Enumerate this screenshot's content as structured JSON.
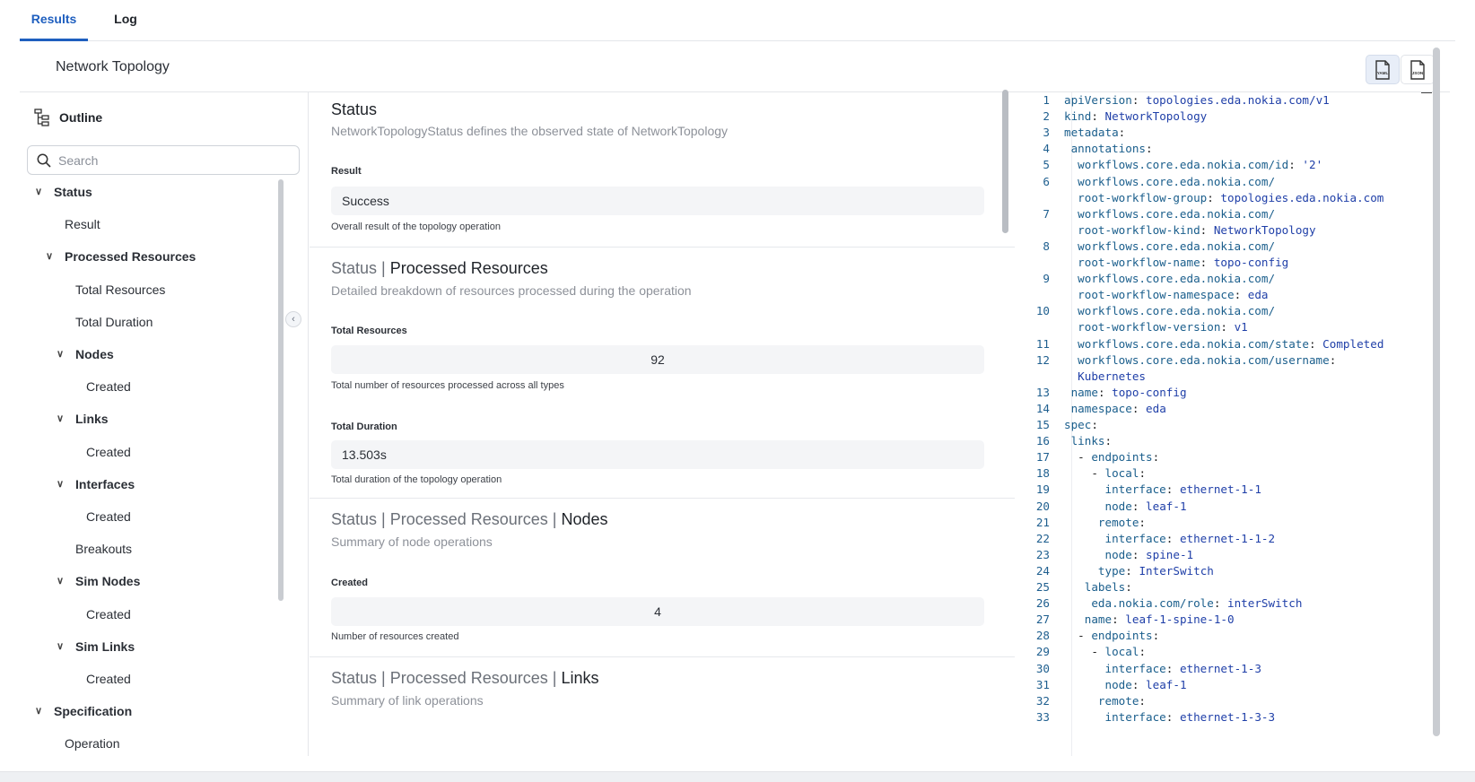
{
  "tabs": {
    "results": "Results",
    "log": "Log"
  },
  "header": {
    "title": "Network Topology",
    "yaml_button": "YAML",
    "json_button": "JSON"
  },
  "outline": {
    "title": "Outline",
    "search_placeholder": "Search",
    "items": [
      {
        "label": "Status",
        "bold": true,
        "chevron": true,
        "indent": 0
      },
      {
        "label": "Result",
        "bold": false,
        "chevron": false,
        "indent": 1
      },
      {
        "label": "Processed Resources",
        "bold": true,
        "chevron": true,
        "indent": 1
      },
      {
        "label": "Total Resources",
        "bold": false,
        "chevron": false,
        "indent": 2
      },
      {
        "label": "Total Duration",
        "bold": false,
        "chevron": false,
        "indent": 2
      },
      {
        "label": "Nodes",
        "bold": true,
        "chevron": true,
        "indent": 2
      },
      {
        "label": "Created",
        "bold": false,
        "chevron": false,
        "indent": 3
      },
      {
        "label": "Links",
        "bold": true,
        "chevron": true,
        "indent": 2
      },
      {
        "label": "Created",
        "bold": false,
        "chevron": false,
        "indent": 3
      },
      {
        "label": "Interfaces",
        "bold": true,
        "chevron": true,
        "indent": 2
      },
      {
        "label": "Created",
        "bold": false,
        "chevron": false,
        "indent": 3
      },
      {
        "label": "Breakouts",
        "bold": false,
        "chevron": false,
        "indent": 2
      },
      {
        "label": "Sim Nodes",
        "bold": true,
        "chevron": true,
        "indent": 2
      },
      {
        "label": "Created",
        "bold": false,
        "chevron": false,
        "indent": 3
      },
      {
        "label": "Sim Links",
        "bold": true,
        "chevron": true,
        "indent": 2
      },
      {
        "label": "Created",
        "bold": false,
        "chevron": false,
        "indent": 3
      },
      {
        "label": "Specification",
        "bold": true,
        "chevron": true,
        "indent": 0
      },
      {
        "label": "Operation",
        "bold": false,
        "chevron": false,
        "indent": 1
      }
    ]
  },
  "sections": {
    "status": {
      "title": "Status",
      "desc": "NetworkTopologyStatus defines the observed state of NetworkTopology",
      "result_label": "Result",
      "result_value": "Success",
      "result_help": "Overall result of the topology operation"
    },
    "processed": {
      "title_prefix": "Status | ",
      "title_strong": "Processed Resources",
      "desc": "Detailed breakdown of resources processed during the operation",
      "total_resources_label": "Total Resources",
      "total_resources_value": "92",
      "total_resources_help": "Total number of resources processed across all types",
      "total_duration_label": "Total Duration",
      "total_duration_value": "13.503s",
      "total_duration_help": "Total duration of the topology operation"
    },
    "nodes": {
      "title_prefix": "Status | Processed Resources | ",
      "title_strong": "Nodes",
      "desc": "Summary of node operations",
      "created_label": "Created",
      "created_value": "4",
      "created_help": "Number of resources created"
    },
    "links": {
      "title_prefix": "Status | Processed Resources | ",
      "title_strong": "Links",
      "desc": "Summary of link operations"
    }
  },
  "code": {
    "lines": [
      {
        "n": "1",
        "rows": [
          {
            "i": 0,
            "k": "apiVersion",
            "v": "topologies.eda.nokia.com/v1"
          }
        ]
      },
      {
        "n": "2",
        "rows": [
          {
            "i": 0,
            "k": "kind",
            "v": "NetworkTopology"
          }
        ]
      },
      {
        "n": "3",
        "rows": [
          {
            "i": 0,
            "k": "metadata",
            "v": ""
          }
        ]
      },
      {
        "n": "4",
        "rows": [
          {
            "i": 1,
            "k": "annotations",
            "v": ""
          }
        ]
      },
      {
        "n": "5",
        "rows": [
          {
            "i": 2,
            "k": "workflows.core.eda.nokia.com/id",
            "v": "'2'"
          }
        ]
      },
      {
        "n": "6",
        "rows": [
          {
            "i": 2,
            "t": "workflows.core.eda.nokia.com/"
          },
          {
            "i": 2,
            "k": "root-workflow-group",
            "v": "topologies.eda.nokia.com"
          }
        ]
      },
      {
        "n": "7",
        "rows": [
          {
            "i": 2,
            "t": "workflows.core.eda.nokia.com/"
          },
          {
            "i": 2,
            "k": "root-workflow-kind",
            "v": "NetworkTopology"
          }
        ]
      },
      {
        "n": "8",
        "rows": [
          {
            "i": 2,
            "t": "workflows.core.eda.nokia.com/"
          },
          {
            "i": 2,
            "k": "root-workflow-name",
            "v": "topo-config"
          }
        ]
      },
      {
        "n": "9",
        "rows": [
          {
            "i": 2,
            "t": "workflows.core.eda.nokia.com/"
          },
          {
            "i": 2,
            "k": "root-workflow-namespace",
            "v": "eda"
          }
        ]
      },
      {
        "n": "10",
        "rows": [
          {
            "i": 2,
            "t": "workflows.core.eda.nokia.com/"
          },
          {
            "i": 2,
            "k": "root-workflow-version",
            "v": "v1"
          }
        ]
      },
      {
        "n": "11",
        "rows": [
          {
            "i": 2,
            "k": "workflows.core.eda.nokia.com/state",
            "v": "Completed"
          }
        ]
      },
      {
        "n": "12",
        "rows": [
          {
            "i": 2,
            "k": "workflows.core.eda.nokia.com/username",
            "v": ""
          },
          {
            "i": 2,
            "t": "Kubernetes",
            "val": true
          }
        ]
      },
      {
        "n": "13",
        "rows": [
          {
            "i": 1,
            "k": "name",
            "v": "topo-config"
          }
        ]
      },
      {
        "n": "14",
        "rows": [
          {
            "i": 1,
            "k": "namespace",
            "v": "eda"
          }
        ]
      },
      {
        "n": "15",
        "rows": [
          {
            "i": 0,
            "k": "spec",
            "v": ""
          }
        ]
      },
      {
        "n": "16",
        "rows": [
          {
            "i": 1,
            "k": "links",
            "v": ""
          }
        ]
      },
      {
        "n": "17",
        "rows": [
          {
            "i": 2,
            "d": "- ",
            "k": "endpoints",
            "v": ""
          }
        ]
      },
      {
        "n": "18",
        "rows": [
          {
            "i": 4,
            "d": "- ",
            "k": "local",
            "v": ""
          }
        ]
      },
      {
        "n": "19",
        "rows": [
          {
            "i": 6,
            "k": "interface",
            "v": "ethernet-1-1"
          }
        ]
      },
      {
        "n": "20",
        "rows": [
          {
            "i": 6,
            "k": "node",
            "v": "leaf-1"
          }
        ]
      },
      {
        "n": "21",
        "rows": [
          {
            "i": 5,
            "k": "remote",
            "v": ""
          }
        ]
      },
      {
        "n": "22",
        "rows": [
          {
            "i": 6,
            "k": "interface",
            "v": "ethernet-1-1-2"
          }
        ]
      },
      {
        "n": "23",
        "rows": [
          {
            "i": 6,
            "k": "node",
            "v": "spine-1"
          }
        ]
      },
      {
        "n": "24",
        "rows": [
          {
            "i": 5,
            "k": "type",
            "v": "InterSwitch"
          }
        ]
      },
      {
        "n": "25",
        "rows": [
          {
            "i": 3,
            "k": "labels",
            "v": ""
          }
        ]
      },
      {
        "n": "26",
        "rows": [
          {
            "i": 4,
            "k": "eda.nokia.com/role",
            "v": "interSwitch"
          }
        ]
      },
      {
        "n": "27",
        "rows": [
          {
            "i": 3,
            "k": "name",
            "v": "leaf-1-spine-1-0"
          }
        ]
      },
      {
        "n": "28",
        "rows": [
          {
            "i": 2,
            "d": "- ",
            "k": "endpoints",
            "v": ""
          }
        ]
      },
      {
        "n": "29",
        "rows": [
          {
            "i": 4,
            "d": "- ",
            "k": "local",
            "v": ""
          }
        ]
      },
      {
        "n": "30",
        "rows": [
          {
            "i": 6,
            "k": "interface",
            "v": "ethernet-1-3"
          }
        ]
      },
      {
        "n": "31",
        "rows": [
          {
            "i": 6,
            "k": "node",
            "v": "leaf-1"
          }
        ]
      },
      {
        "n": "32",
        "rows": [
          {
            "i": 5,
            "k": "remote",
            "v": ""
          }
        ]
      },
      {
        "n": "33",
        "rows": [
          {
            "i": 6,
            "k": "interface",
            "v": "ethernet-1-3-3"
          }
        ]
      }
    ]
  },
  "colors": {
    "accent": "#1f5fbf",
    "code_key": "#1a5e8c",
    "code_value": "#1f3fa8"
  }
}
